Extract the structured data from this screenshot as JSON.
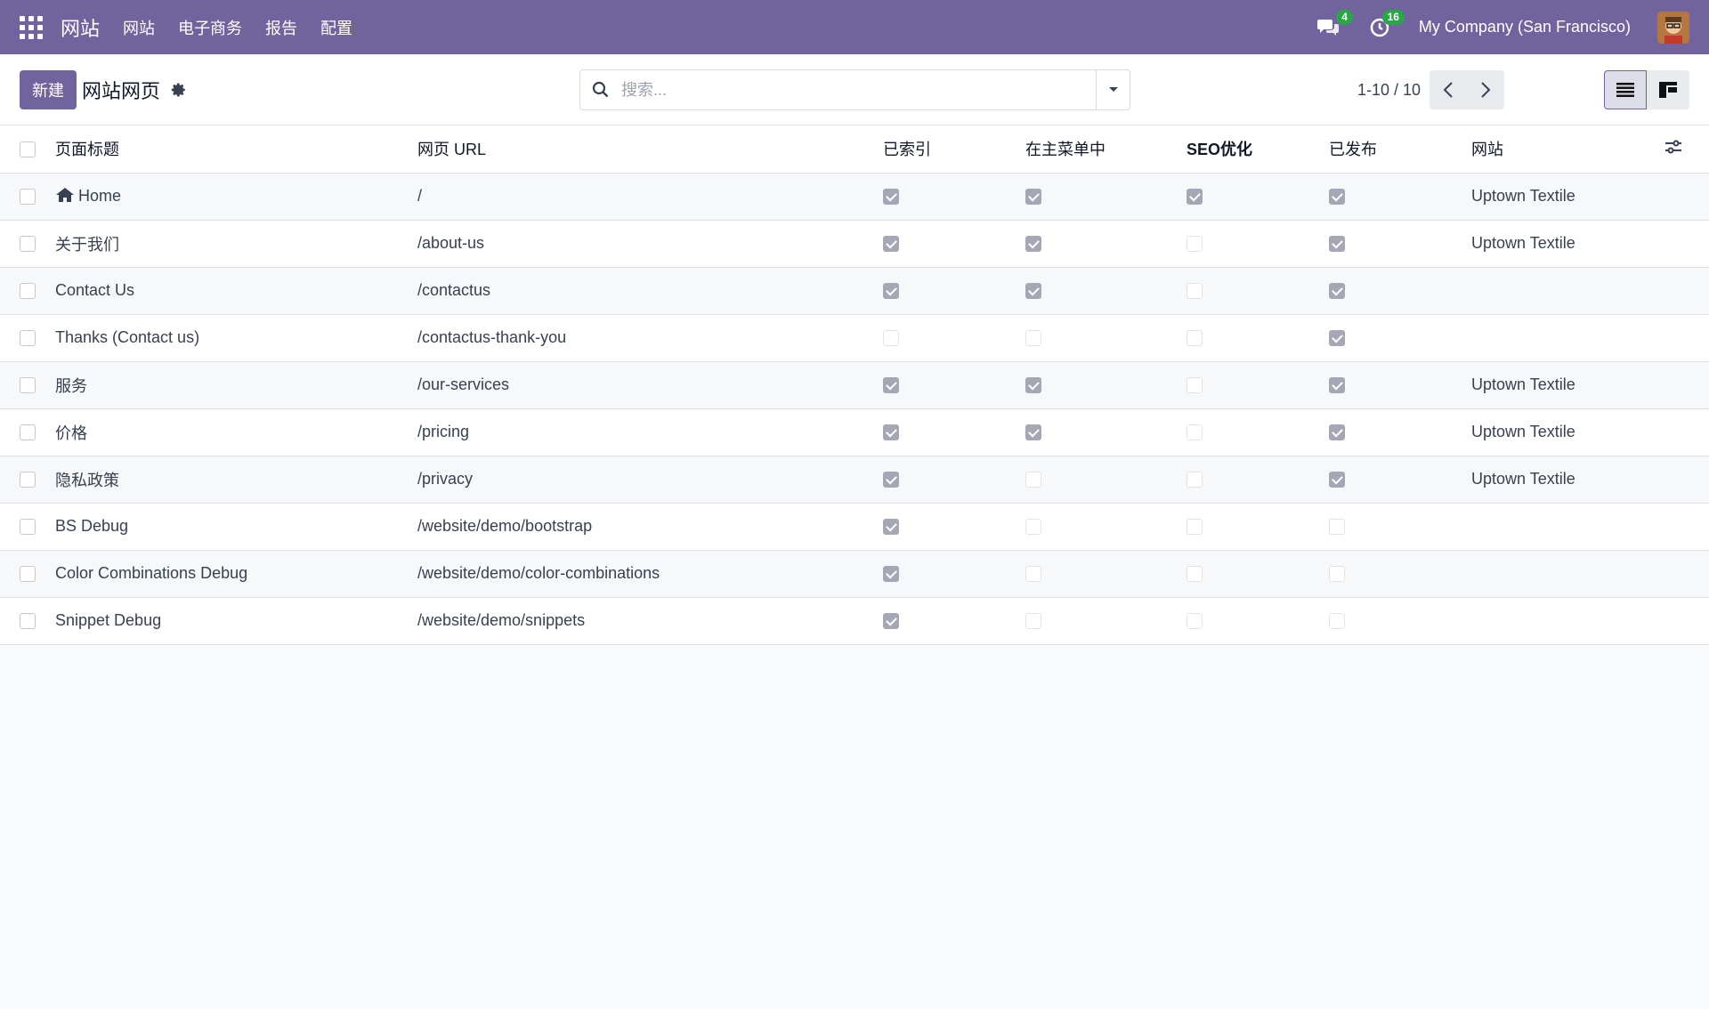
{
  "navbar": {
    "brand": "网站",
    "menu": [
      "网站",
      "电子商务",
      "报告",
      "配置"
    ],
    "messages_count": "4",
    "activities_count": "16",
    "company": "My Company (San Francisco)"
  },
  "control": {
    "new_label": "新建",
    "title": "网站网页",
    "search_placeholder": "搜索...",
    "pager": "1-10 / 10"
  },
  "table": {
    "headers": [
      "页面标题",
      "网页 URL",
      "已索引",
      "在主菜单中",
      "SEO优化",
      "已发布",
      "网站"
    ],
    "rows": [
      {
        "title": "Home",
        "url": "/",
        "indexed": true,
        "menu": true,
        "seo": true,
        "published": true,
        "website": "Uptown Textile",
        "home": true
      },
      {
        "title": "关于我们",
        "url": "/about-us",
        "indexed": true,
        "menu": true,
        "seo": false,
        "published": true,
        "website": "Uptown Textile"
      },
      {
        "title": "Contact Us",
        "url": "/contactus",
        "indexed": true,
        "menu": true,
        "seo": false,
        "published": true,
        "website": ""
      },
      {
        "title": "Thanks (Contact us)",
        "url": "/contactus-thank-you",
        "indexed": false,
        "menu": false,
        "seo": false,
        "published": true,
        "website": ""
      },
      {
        "title": "服务",
        "url": "/our-services",
        "indexed": true,
        "menu": true,
        "seo": false,
        "published": true,
        "website": "Uptown Textile"
      },
      {
        "title": "价格",
        "url": "/pricing",
        "indexed": true,
        "menu": true,
        "seo": false,
        "published": true,
        "website": "Uptown Textile"
      },
      {
        "title": "隐私政策",
        "url": "/privacy",
        "indexed": true,
        "menu": false,
        "seo": false,
        "published": true,
        "website": "Uptown Textile"
      },
      {
        "title": "BS Debug",
        "url": "/website/demo/bootstrap",
        "indexed": true,
        "menu": false,
        "seo": false,
        "published": false,
        "website": ""
      },
      {
        "title": "Color Combinations Debug",
        "url": "/website/demo/color-combinations",
        "indexed": true,
        "menu": false,
        "seo": false,
        "published": false,
        "website": ""
      },
      {
        "title": "Snippet Debug",
        "url": "/website/demo/snippets",
        "indexed": true,
        "menu": false,
        "seo": false,
        "published": false,
        "website": ""
      }
    ]
  },
  "colors": {
    "brand": "#71639e",
    "badge": "#28a745"
  }
}
